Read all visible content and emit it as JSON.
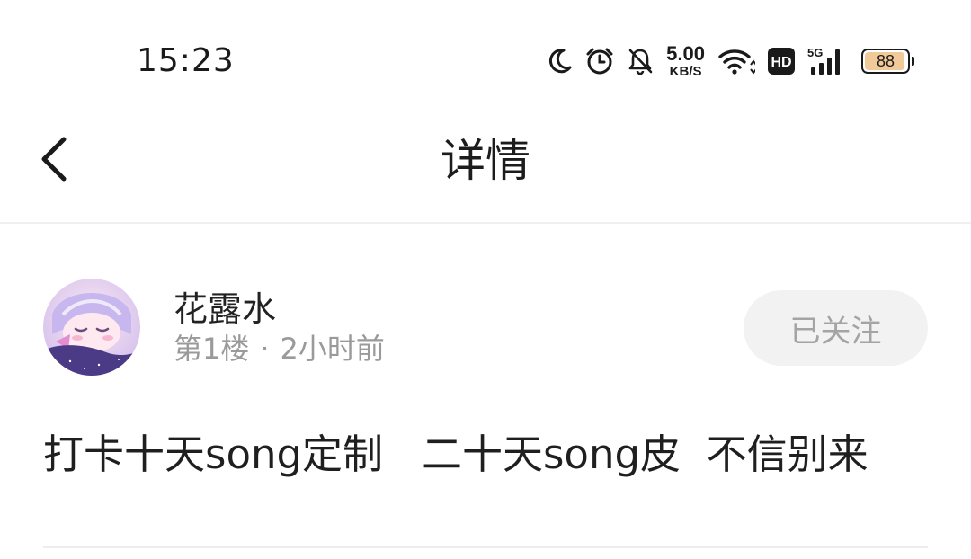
{
  "status_bar": {
    "time": "15:23",
    "net_speed_value": "5.00",
    "net_speed_unit": "KB/S",
    "hd_label": "HD",
    "network_label": "5G",
    "battery_level": "88",
    "icons": [
      "moon-icon",
      "alarm-icon",
      "bell-muted-icon",
      "wifi-icon",
      "hd-icon",
      "signal-icon",
      "battery-icon"
    ]
  },
  "header": {
    "title": "详情"
  },
  "post": {
    "author": "花露水",
    "floor": "第1楼",
    "separator": "·",
    "time_ago": "2小时前",
    "follow_label": "已关注",
    "content": "打卡十天song定制   二十天song皮  不信别来"
  },
  "colors": {
    "background": "#ffffff",
    "text_primary": "#222222",
    "text_secondary": "#9a9a9a",
    "follow_bg": "#f2f2f2",
    "battery_fill": "#f2c998",
    "divider": "#ededed"
  }
}
